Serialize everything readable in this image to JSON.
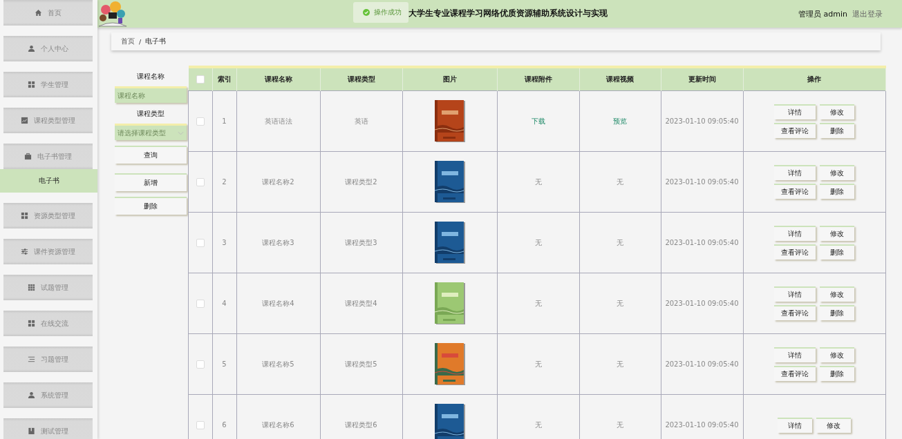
{
  "sidebar": {
    "items": [
      {
        "label": "首页",
        "kind": "home",
        "selected": false
      },
      {
        "label": "个人中心",
        "kind": "person",
        "selected": false
      },
      {
        "label": "学生管理",
        "kind": "grid",
        "selected": false
      },
      {
        "label": "课程类型管理",
        "kind": "chart",
        "selected": false
      },
      {
        "label": "电子书管理",
        "kind": "case",
        "selected": false,
        "expanded": true,
        "children": [
          {
            "label": "电子书",
            "selected": true
          }
        ]
      },
      {
        "label": "资源类型管理",
        "kind": "grid",
        "selected": false
      },
      {
        "label": "课件资源管理",
        "kind": "sliders",
        "selected": false
      },
      {
        "label": "试题管理",
        "kind": "grid9",
        "selected": false
      },
      {
        "label": "在线交流",
        "kind": "grid",
        "selected": false
      },
      {
        "label": "习题管理",
        "kind": "list",
        "selected": false
      },
      {
        "label": "系统管理",
        "kind": "person",
        "selected": false
      },
      {
        "label": "测试管理",
        "kind": "book",
        "selected": false
      }
    ]
  },
  "header": {
    "title": "大学生专业课程学习网络优质资源辅助系统设计与实现",
    "user": "管理员 admin",
    "logout": "退出登录"
  },
  "toast": {
    "text": "操作成功"
  },
  "breadcrumb": {
    "separator": "/",
    "items": [
      "首页",
      "电子书"
    ]
  },
  "filters": {
    "name_label": "课程名称",
    "name_placeholder": "课程名称",
    "type_label": "课程类型",
    "type_placeholder": "请选择课程类型",
    "buttons": [
      "查询",
      "新增",
      "删除"
    ]
  },
  "table": {
    "select_all": {
      "checked": false
    },
    "columns": [
      "索引",
      "课程名称",
      "课程类型",
      "图片",
      "课程附件",
      "课程视频",
      "更新时间",
      "操作"
    ],
    "rows": [
      {
        "checked": false,
        "index": "1",
        "name": "英语语法",
        "type": "英语",
        "image": {
          "kind": "picture"
        },
        "attachment": {
          "text": "下载",
          "kind": "link"
        },
        "video": {
          "text": "预览",
          "kind": "link"
        },
        "time": "2023-01-10 09:05:40",
        "actions": [
          "详情",
          "修改",
          "查看评论",
          "删除"
        ]
      },
      {
        "checked": false,
        "index": "2",
        "name": "课程名称2",
        "type": "课程类型2",
        "image": {
          "kind": "picture"
        },
        "attachment": {
          "text": "无",
          "kind": "text"
        },
        "video": {
          "text": "无",
          "kind": "text"
        },
        "time": "2023-01-10 09:05:40",
        "actions": [
          "详情",
          "修改",
          "查看评论",
          "删除"
        ]
      },
      {
        "checked": false,
        "index": "3",
        "name": "课程名称3",
        "type": "课程类型3",
        "image": {
          "kind": "picture"
        },
        "attachment": {
          "text": "无",
          "kind": "text"
        },
        "video": {
          "text": "无",
          "kind": "text"
        },
        "time": "2023-01-10 09:05:40",
        "actions": [
          "详情",
          "修改",
          "查看评论",
          "删除"
        ]
      },
      {
        "checked": false,
        "index": "4",
        "name": "课程名称4",
        "type": "课程类型4",
        "image": {
          "kind": "picture"
        },
        "attachment": {
          "text": "无",
          "kind": "text"
        },
        "video": {
          "text": "无",
          "kind": "text"
        },
        "time": "2023-01-10 09:05:40",
        "actions": [
          "详情",
          "修改",
          "查看评论",
          "删除"
        ]
      },
      {
        "checked": false,
        "index": "5",
        "name": "课程名称5",
        "type": "课程类型5",
        "image": {
          "kind": "picture"
        },
        "attachment": {
          "text": "无",
          "kind": "text"
        },
        "video": {
          "text": "无",
          "kind": "text"
        },
        "time": "2023-01-10 09:05:40",
        "actions": [
          "详情",
          "修改",
          "查看评论",
          "删除"
        ]
      },
      {
        "checked": false,
        "index": "6",
        "name": "课程名称6",
        "type": "课程类型6",
        "image": {
          "kind": "picture"
        },
        "attachment": {
          "text": "无",
          "kind": "text"
        },
        "video": {
          "text": "无",
          "kind": "text"
        },
        "time": "2023-01-10 09:05:40",
        "actions": [
          "详情",
          "修改"
        ]
      }
    ]
  }
}
